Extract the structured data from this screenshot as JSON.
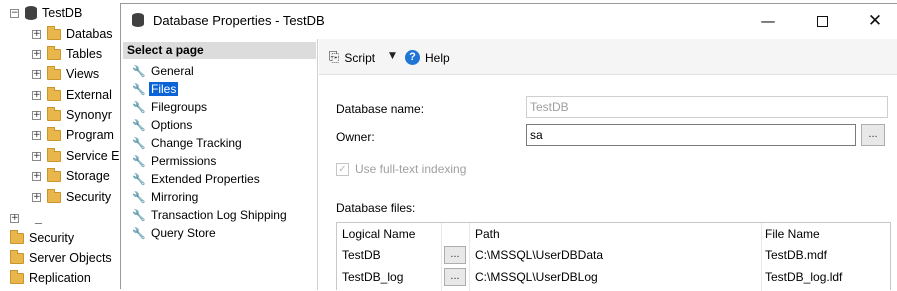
{
  "explorer": {
    "db_name": "TestDB",
    "db_children": [
      "Databas",
      "Tables",
      "Views",
      "External",
      "Synonyr",
      "Program",
      "Service E",
      "Storage",
      "Security"
    ],
    "collapsed_dash": "_",
    "root_items": [
      "Security",
      "Server Objects",
      "Replication"
    ]
  },
  "dialog": {
    "title": "Database Properties - TestDB",
    "select_page": "Select a page",
    "pages": [
      "General",
      "Files",
      "Filegroups",
      "Options",
      "Change Tracking",
      "Permissions",
      "Extended Properties",
      "Mirroring",
      "Transaction Log Shipping",
      "Query Store"
    ],
    "selected_page": "Files",
    "toolbar": {
      "script": "Script",
      "help": "Help"
    },
    "db_name_label": "Database name:",
    "db_name_value": "TestDB",
    "owner_label": "Owner:",
    "owner_value": "sa",
    "ellipsis": "...",
    "fulltext_label": "Use full-text indexing",
    "db_files_label": "Database files:",
    "grid": {
      "headers": [
        "Logical Name",
        "Path",
        "File Name"
      ],
      "rows": [
        {
          "logical": "TestDB",
          "path": "C:\\MSSQL\\UserDBData",
          "file": "TestDB.mdf"
        },
        {
          "logical": "TestDB_log",
          "path": "C:\\MSSQL\\UserDBLog",
          "file": "TestDB_log.ldf"
        }
      ]
    }
  },
  "colors": {
    "selection": "#0a64d8",
    "header_bg": "#dcdcdc",
    "folder": "#e8b64a"
  }
}
